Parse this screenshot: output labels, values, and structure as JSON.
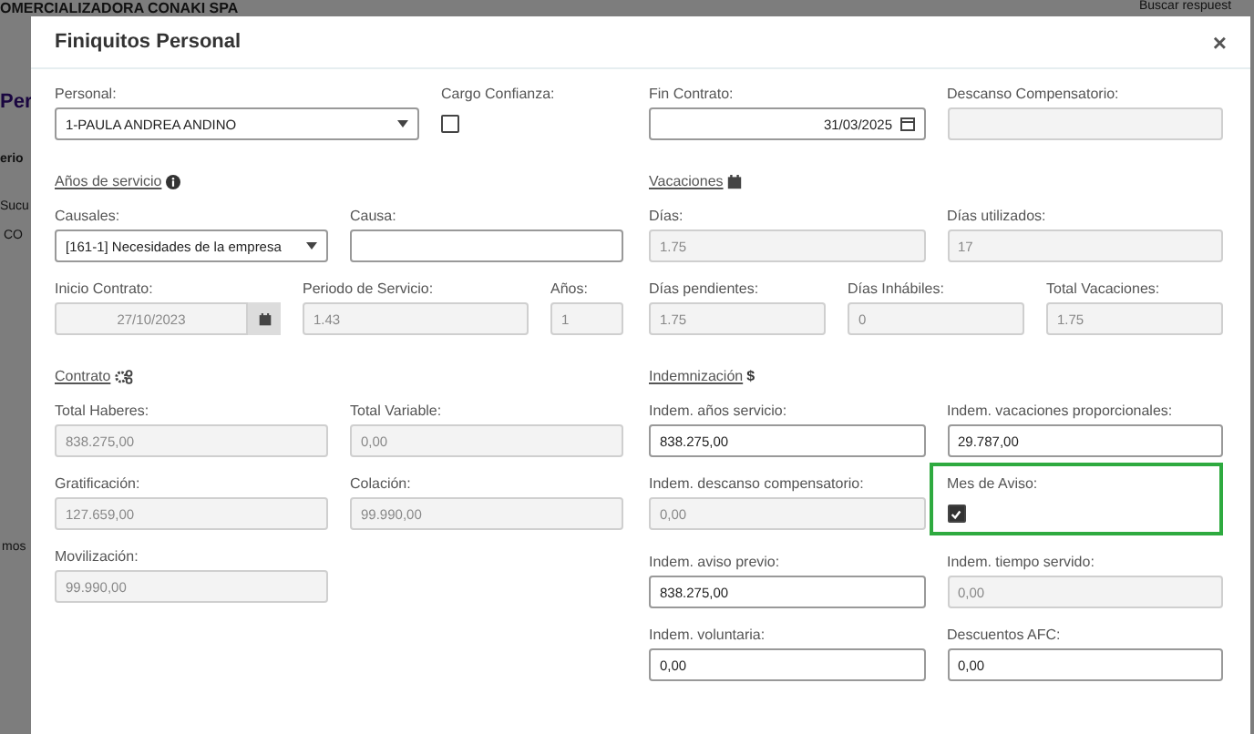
{
  "background": {
    "company": "OMERCIALIZADORA CONAKI SPA",
    "page_title": "Per",
    "fragments": [
      "erio",
      "Sucu",
      "CO",
      "mos"
    ],
    "search": "Buscar respuest"
  },
  "modal": {
    "title": "Finiquitos Personal",
    "close": "×"
  },
  "columns": [
    [
      {
        "rows": [
          [
            {
              "kind": "select",
              "label": "Personal:",
              "value": "1-PAULA ANDREA ANDINO",
              "disabled": false
            },
            {
              "kind": "checkbox",
              "label": "Cargo Confianza:",
              "checked": false,
              "highlighted": false
            }
          ]
        ]
      },
      {
        "title": "Años de servicio",
        "rows": [
          [
            {
              "kind": "select",
              "label": "Causales:",
              "value": "[161-1] Necesidades de la empresa",
              "disabled": false
            },
            {
              "kind": "text",
              "label": "Causa:",
              "disabled": false
            }
          ],
          [
            {
              "kind": "date_button",
              "label": "Inicio Contrato:",
              "value": "27/10/2023",
              "disabled": true
            },
            {
              "kind": "text",
              "label": "Periodo de Servicio:",
              "value": "1.43",
              "disabled": true
            },
            {
              "kind": "text",
              "label": "Años:",
              "value": "1",
              "disabled": true
            }
          ]
        ]
      },
      {
        "title": "Contrato",
        "rows": [
          [
            {
              "kind": "text",
              "label": "Total Haberes:",
              "value": "838.275,00",
              "disabled": true
            },
            {
              "kind": "text",
              "label": "Total Variable:",
              "value": "0,00",
              "disabled": true
            }
          ],
          [
            {
              "kind": "text",
              "label": "Gratificación:",
              "value": "127.659,00",
              "disabled": true
            },
            {
              "kind": "text",
              "label": "Colación:",
              "value": "99.990,00",
              "disabled": true
            }
          ],
          [
            {
              "kind": "text",
              "label": "Movilización:",
              "value": "99.990,00",
              "disabled": true
            }
          ]
        ]
      }
    ],
    [
      {
        "rows": [
          [
            {
              "kind": "date",
              "label": "Fin Contrato:",
              "value": "31/03/2025",
              "disabled": false
            },
            {
              "kind": "text",
              "label": "Descanso Compensatorio:",
              "disabled": true
            }
          ]
        ]
      },
      {
        "title": "Vacaciones",
        "rows": [
          [
            {
              "kind": "text",
              "label": "Días:",
              "value": "1.75",
              "disabled": true
            },
            {
              "kind": "text",
              "label": "Días utilizados:",
              "value": "17",
              "disabled": true
            }
          ],
          [
            {
              "kind": "text",
              "label": "Días pendientes:",
              "value": "1.75",
              "disabled": true
            },
            {
              "kind": "text",
              "label": "Días Inhábiles:",
              "value": "0",
              "disabled": true
            },
            {
              "kind": "text",
              "label": "Total Vacaciones:",
              "value": "1.75",
              "disabled": true
            }
          ]
        ]
      },
      {
        "title": "Indemnización",
        "symbol": "$",
        "rows": [
          [
            {
              "kind": "text",
              "label": "Indem. años servicio:",
              "value": "838.275,00",
              "disabled": false
            },
            {
              "kind": "text",
              "label": "Indem. vacaciones proporcionales:",
              "value": "29.787,00",
              "disabled": false
            }
          ],
          [
            {
              "kind": "text",
              "label": "Indem. descanso compensatorio:",
              "value": "0,00",
              "disabled": true
            },
            {
              "kind": "checkbox",
              "label": "Mes de Aviso:",
              "checked": true,
              "highlighted": true
            }
          ],
          [
            {
              "kind": "text",
              "label": "Indem. aviso previo:",
              "value": "838.275,00",
              "disabled": false
            },
            {
              "kind": "text",
              "label": "Indem. tiempo servido:",
              "value": "0,00",
              "disabled": true
            }
          ],
          [
            {
              "kind": "text",
              "label": "Indem. voluntaria:",
              "value": "0,00",
              "disabled": false
            },
            {
              "kind": "text",
              "label": "Descuentos AFC:",
              "value": "0,00",
              "disabled": false
            }
          ]
        ]
      }
    ]
  ]
}
